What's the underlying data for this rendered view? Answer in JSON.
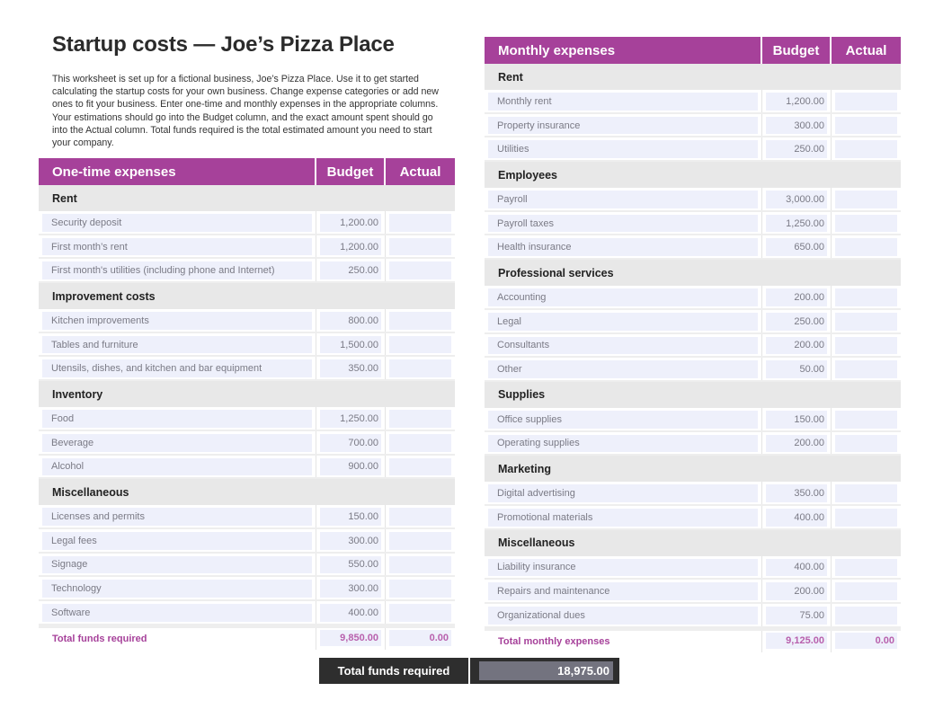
{
  "page": {
    "title": "Startup costs — Joe’s Pizza Place",
    "intro": "This worksheet is set up for a fictional business, Joe’s Pizza Place. Use it to get started calculating the startup costs for your own business. Change expense categories or add new ones to fit your business. Enter one-time and monthly expenses in the appropriate columns. Your estimations should go into the Budget column, and the exact amount spent should go into the Actual column. Total funds required is the total estimated amount you need to start your company.",
    "accent_color": "#a6419a"
  },
  "one_time": {
    "header": {
      "name": "One-time expenses",
      "budget": "Budget",
      "actual": "Actual"
    },
    "categories": [
      {
        "name": "Rent",
        "items": [
          {
            "label": "Security deposit",
            "budget": "1,200.00",
            "actual": ""
          },
          {
            "label": "First month’s rent",
            "budget": "1,200.00",
            "actual": ""
          },
          {
            "label": "First month's utilities (including phone and Internet)",
            "budget": "250.00",
            "actual": ""
          }
        ]
      },
      {
        "name": "Improvement costs",
        "items": [
          {
            "label": "Kitchen improvements",
            "budget": "800.00",
            "actual": ""
          },
          {
            "label": "Tables and furniture",
            "budget": "1,500.00",
            "actual": ""
          },
          {
            "label": "Utensils, dishes, and kitchen and bar equipment",
            "budget": "350.00",
            "actual": ""
          }
        ]
      },
      {
        "name": "Inventory",
        "items": [
          {
            "label": "Food",
            "budget": "1,250.00",
            "actual": ""
          },
          {
            "label": "Beverage",
            "budget": "700.00",
            "actual": ""
          },
          {
            "label": "Alcohol",
            "budget": "900.00",
            "actual": ""
          }
        ]
      },
      {
        "name": "Miscellaneous",
        "items": [
          {
            "label": "Licenses and permits",
            "budget": "150.00",
            "actual": ""
          },
          {
            "label": "Legal fees",
            "budget": "300.00",
            "actual": ""
          },
          {
            "label": "Signage",
            "budget": "550.00",
            "actual": ""
          },
          {
            "label": "Technology",
            "budget": "300.00",
            "actual": ""
          },
          {
            "label": "Software",
            "budget": "400.00",
            "actual": ""
          }
        ]
      }
    ],
    "total": {
      "label": "Total funds required",
      "budget": "9,850.00",
      "actual": "0.00"
    }
  },
  "monthly": {
    "header": {
      "name": "Monthly expenses",
      "budget": "Budget",
      "actual": "Actual"
    },
    "categories": [
      {
        "name": "Rent",
        "items": [
          {
            "label": "Monthly rent",
            "budget": "1,200.00",
            "actual": ""
          },
          {
            "label": "Property insurance",
            "budget": "300.00",
            "actual": ""
          },
          {
            "label": "Utilities",
            "budget": "250.00",
            "actual": ""
          }
        ]
      },
      {
        "name": "Employees",
        "items": [
          {
            "label": "Payroll",
            "budget": "3,000.00",
            "actual": ""
          },
          {
            "label": "Payroll taxes",
            "budget": "1,250.00",
            "actual": ""
          },
          {
            "label": "Health insurance",
            "budget": "650.00",
            "actual": ""
          }
        ]
      },
      {
        "name": "Professional services",
        "items": [
          {
            "label": "Accounting",
            "budget": "200.00",
            "actual": ""
          },
          {
            "label": "Legal",
            "budget": "250.00",
            "actual": ""
          },
          {
            "label": "Consultants",
            "budget": "200.00",
            "actual": ""
          },
          {
            "label": "Other",
            "budget": "50.00",
            "actual": ""
          }
        ]
      },
      {
        "name": "Supplies",
        "items": [
          {
            "label": "Office supplies",
            "budget": "150.00",
            "actual": ""
          },
          {
            "label": "Operating supplies",
            "budget": "200.00",
            "actual": ""
          }
        ]
      },
      {
        "name": "Marketing",
        "items": [
          {
            "label": "Digital advertising",
            "budget": "350.00",
            "actual": ""
          },
          {
            "label": "Promotional materials",
            "budget": "400.00",
            "actual": ""
          }
        ]
      },
      {
        "name": "Miscellaneous",
        "items": [
          {
            "label": "Liability insurance",
            "budget": "400.00",
            "actual": ""
          },
          {
            "label": "Repairs and maintenance",
            "budget": "200.00",
            "actual": ""
          },
          {
            "label": "Organizational dues",
            "budget": "75.00",
            "actual": ""
          }
        ]
      }
    ],
    "total": {
      "label": "Total monthly expenses",
      "budget": "9,125.00",
      "actual": "0.00"
    }
  },
  "grand_total": {
    "label": "Total funds required",
    "value": "18,975.00"
  }
}
